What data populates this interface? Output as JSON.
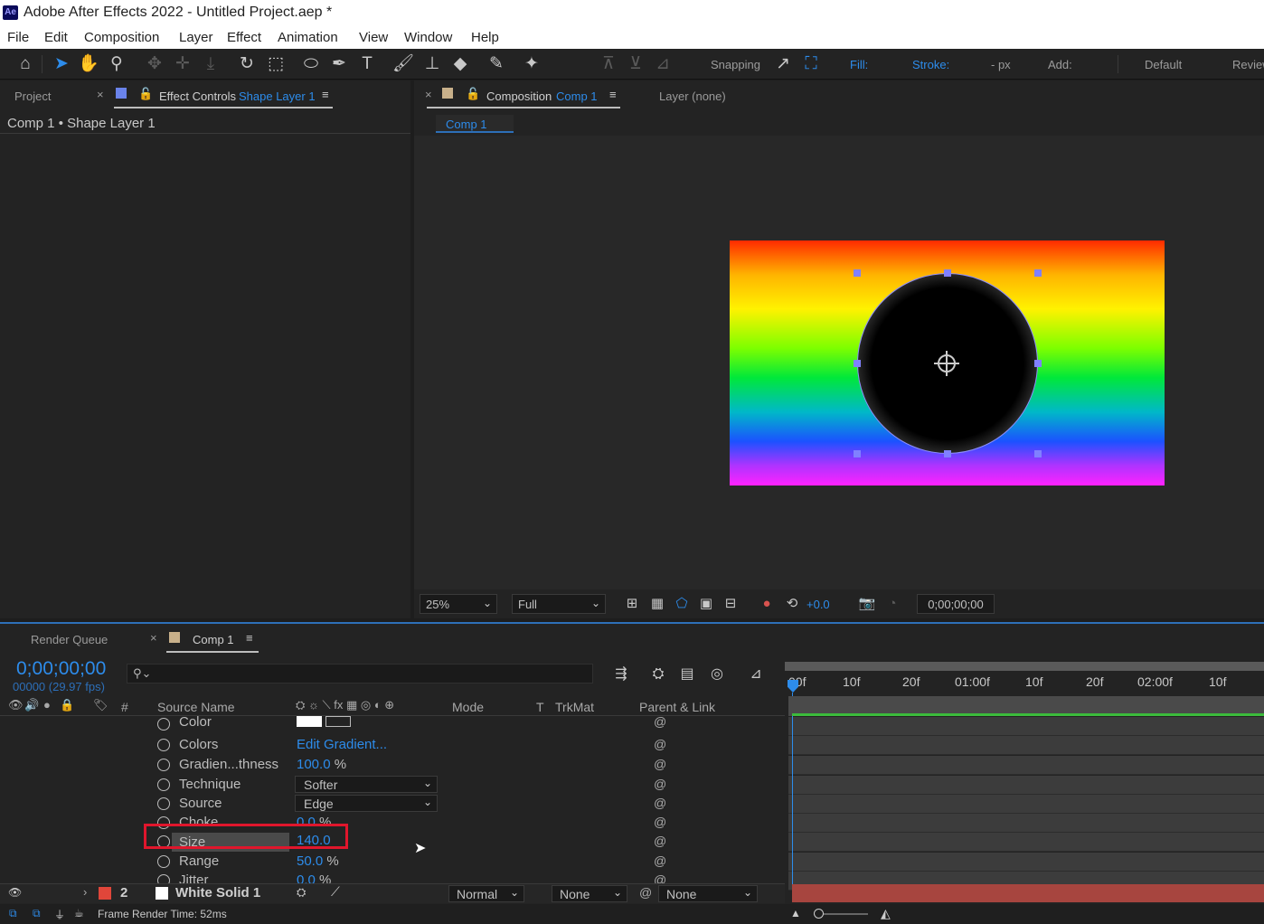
{
  "app": {
    "title": "Adobe After Effects 2022 - Untitled Project.aep *",
    "icon_label": "Ae"
  },
  "menu": [
    "File",
    "Edit",
    "Composition",
    "Layer",
    "Effect",
    "Animation",
    "View",
    "Window",
    "Help"
  ],
  "toolbar": {
    "snapping_label": "Snapping",
    "fill_label": "Fill:",
    "stroke_label": "Stroke:",
    "stroke_width": "- px",
    "add_label": "Add:",
    "workspace_default": "Default",
    "workspace_review": "Review"
  },
  "left_panel": {
    "tab_project": "Project",
    "tab_effect_controls": "Effect Controls",
    "tab_effect_controls_target": "Shape Layer 1",
    "breadcrumb": "Comp 1 • Shape Layer 1"
  },
  "comp_panel": {
    "tab_label": "Composition",
    "tab_target": "Comp 1",
    "layer_tab": "Layer (none)",
    "subtab": "Comp 1",
    "zoom": "25%",
    "resolution": "Full",
    "exposure": "+0.0",
    "timecode": "0;00;00;00"
  },
  "timeline": {
    "tab_render_queue": "Render Queue",
    "tab_comp": "Comp 1",
    "current_time": "0;00;00;00",
    "frame_info": "00000 (29.97 fps)",
    "search_placeholder": "",
    "columns": {
      "num": "#",
      "source_name": "Source Name",
      "mode": "Mode",
      "t": "T",
      "trkmat": "TrkMat",
      "parent_link": "Parent & Link"
    },
    "ruler": [
      "00f",
      "10f",
      "20f",
      "01:00f",
      "10f",
      "20f",
      "02:00f",
      "10f"
    ],
    "properties": [
      {
        "name": "Color",
        "value": "",
        "unit": ""
      },
      {
        "name": "Colors",
        "value": "Edit Gradient...",
        "unit": ""
      },
      {
        "name": "Gradien...thness",
        "value": "100.0",
        "unit": "%"
      },
      {
        "name": "Technique",
        "value": "Softer",
        "unit": ""
      },
      {
        "name": "Source",
        "value": "Edge",
        "unit": ""
      },
      {
        "name": "Choke",
        "value": "0.0",
        "unit": "%"
      },
      {
        "name": "Size",
        "value": "140.0",
        "unit": ""
      },
      {
        "name": "Range",
        "value": "50.0",
        "unit": "%"
      },
      {
        "name": "Jitter",
        "value": "0.0",
        "unit": "%"
      }
    ],
    "layer2": {
      "number": "2",
      "name": "White Solid 1",
      "mode": "Normal",
      "trkmat": "None",
      "parent": "None",
      "label_color": "#e0463a"
    },
    "status": "Frame Render Time: 52ms"
  },
  "colors": {
    "accent": "#2d8ceb",
    "highlight_box": "#e0162c",
    "panel_bg": "#232323"
  }
}
